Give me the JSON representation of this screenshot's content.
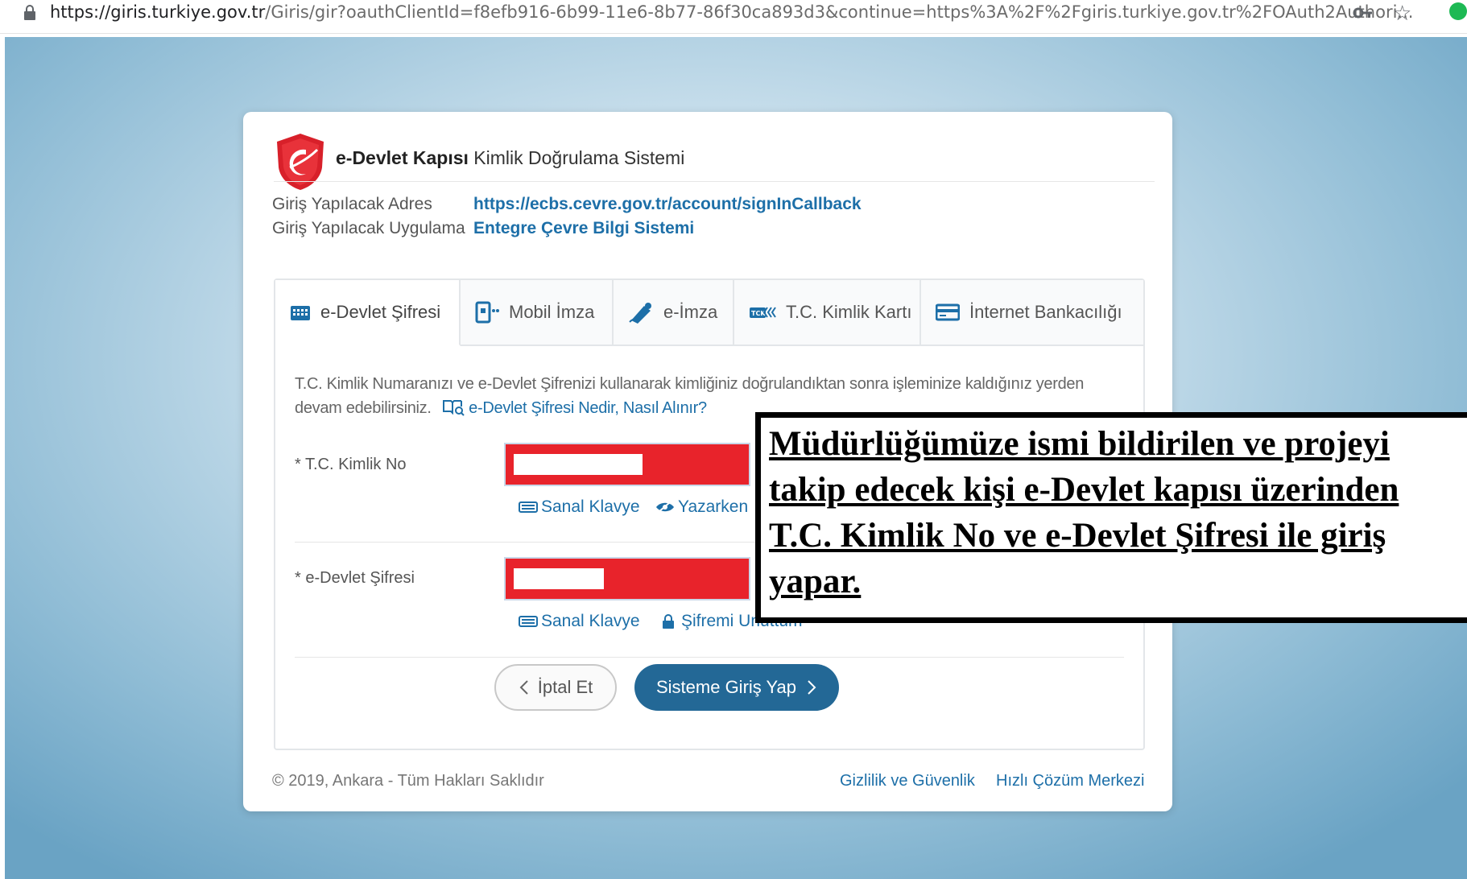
{
  "browser": {
    "url_host": "https://giris.turkiye.gov.tr",
    "url_rest": "/Giris/gir?oauthClientId=f8efb916-6b99-11e6-8b77-86f30ca893d3&continue=https%3A%2F%2Fgiris.turkiye.gov.tr%2FOAuth2Authori..."
  },
  "header": {
    "brand_bold": "e-Devlet Kapısı",
    "brand_rest": " Kimlik Doğrulama Sistemi"
  },
  "info": {
    "address_label": "Giriş Yapılacak Adres",
    "address_value": "https://ecbs.cevre.gov.tr/account/signInCallback",
    "app_label": "Giriş Yapılacak Uygulama",
    "app_value": "Entegre Çevre Bilgi Sistemi"
  },
  "tabs": [
    {
      "label": "e-Devlet Şifresi",
      "icon": "keypad-icon",
      "active": true
    },
    {
      "label": "Mobil İmza",
      "icon": "mobile-signature-icon",
      "active": false
    },
    {
      "label": "e-İmza",
      "icon": "e-signature-icon",
      "active": false
    },
    {
      "label": "T.C. Kimlik Kartı",
      "icon": "id-card-icon",
      "active": false
    },
    {
      "label": "İnternet Bankacılığı",
      "icon": "bank-card-icon",
      "active": false
    }
  ],
  "form": {
    "description": "T.C. Kimlik Numaranızı ve e-Devlet Şifrenizi kullanarak kimliğiniz doğrulandıktan sonra işleminize kaldığınız yerden devam edebilirsiniz.",
    "help_link": "e-Devlet Şifresi Nedir, Nasıl Alınır?",
    "tc_label": "* T.C. Kimlik No",
    "password_label": "* e-Devlet Şifresi",
    "virtual_keyboard": "Sanal Klavye",
    "show_while_typing": "Yazarken",
    "forgot_password": "Şifremi Unuttum",
    "cancel_label": "İptal Et",
    "login_label": "Sisteme Giriş Yap"
  },
  "footer": {
    "copyright": "© 2019, Ankara - Tüm Hakları Saklıdır",
    "privacy": "Gizlilik ve Güvenlik",
    "help_center": "Hızlı Çözüm Merkezi"
  },
  "overlay": {
    "text": "Müdürlüğümüze ismi bildirilen ve projeyi takip edecek kişi e-Devlet  kapısı üzerinden T.C. Kimlik No ve e-Devlet Şifresi ile giriş yapar."
  },
  "colors": {
    "link_blue": "#1d6fa8",
    "primary_button": "#236896",
    "redaction_red": "#e8232b"
  }
}
